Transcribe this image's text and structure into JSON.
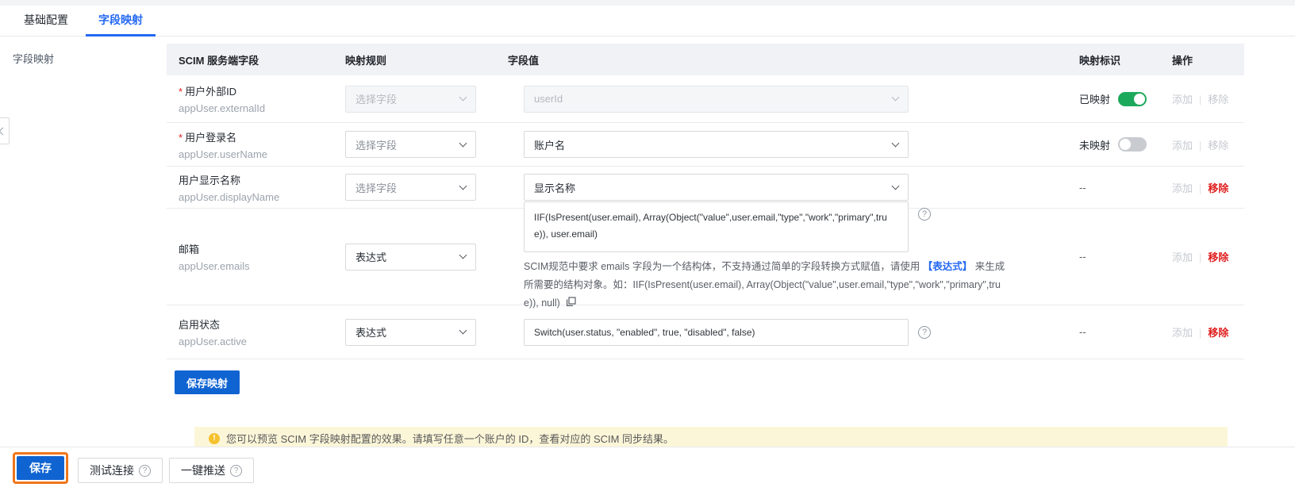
{
  "icons": {
    "question": "?",
    "exclamation": "!"
  },
  "tabs": {
    "basic": "基础配置",
    "mapping": "字段映射"
  },
  "sidebar_label": "字段映射",
  "table": {
    "headers": {
      "field": "SCIM 服务端字段",
      "rule": "映射规则",
      "value": "字段值",
      "flag": "映射标识",
      "actions": "操作"
    },
    "required_marker": "*",
    "actions_separator": "|",
    "rows": [
      {
        "name": "用户外部ID",
        "key": "appUser.externalId",
        "rule": "选择字段",
        "value": "userId",
        "flag_label": "已映射",
        "add": "添加",
        "remove": "移除"
      },
      {
        "name": "用户登录名",
        "key": "appUser.userName",
        "rule": "选择字段",
        "value": "账户名",
        "flag_label": "未映射",
        "add": "添加",
        "remove": "移除"
      },
      {
        "name": "用户显示名称",
        "key": "appUser.displayName",
        "rule": "选择字段",
        "value": "显示名称",
        "flag_label": "--",
        "add": "添加",
        "remove": "移除"
      },
      {
        "name": "邮箱",
        "key": "appUser.emails",
        "rule": "表达式",
        "value": "IIF(IsPresent(user.email), Array(Object(\"value\",user.email,\"type\",\"work\",\"primary\",true)), user.email)",
        "flag_label": "--",
        "add": "添加",
        "remove": "移除",
        "hint_prefix": "SCIM规范中要求 emails 字段为一个结构体，不支持通过简单的字段转换方式赋值，请使用 ",
        "hint_link": "【表达式】",
        "hint_suffix": " 来生成所需要的结构对象。如：IIF(IsPresent(user.email), Array(Object(\"value\",user.email,\"type\",\"work\",\"primary\",true)), null) "
      },
      {
        "name": "启用状态",
        "key": "appUser.active",
        "rule": "表达式",
        "value": "Switch(user.status, \"enabled\", true, \"disabled\", false)",
        "flag_label": "--",
        "add": "添加",
        "remove": "移除"
      }
    ]
  },
  "save_mapping_button": "保存映射",
  "notice": "您可以预览 SCIM 字段映射配置的效果。请填写任意一个账户的 ID，查看对应的 SCIM 同步结果。",
  "footer": {
    "save": "保存",
    "test": "测试连接",
    "push": "一键推送"
  },
  "colors": {
    "accent": "#2468f2",
    "primary_button": "#1064d2",
    "toggle_on": "#1ca95c",
    "danger": "#e02020",
    "warning_bg": "#fcf6d9",
    "warning_icon": "#f5c12e",
    "highlight_outline": "#f0761a"
  }
}
